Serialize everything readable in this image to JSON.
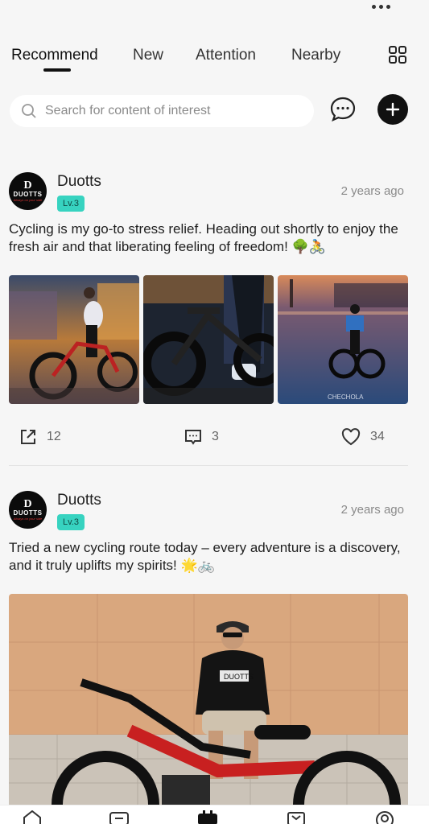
{
  "tabs": [
    {
      "label": "Recommend",
      "active": true
    },
    {
      "label": "New",
      "active": false
    },
    {
      "label": "Attention",
      "active": false
    },
    {
      "label": "Nearby",
      "active": false
    }
  ],
  "search": {
    "placeholder": "Search for content of interest"
  },
  "colors": {
    "accent": "#111111",
    "level_badge": "#37d3c0",
    "background": "#f6f6f6"
  },
  "icons": {
    "more": "more-horizontal-icon",
    "grid": "grid-icon",
    "search": "search-icon",
    "chat": "chat-bubble-icon",
    "add": "plus-icon",
    "share": "share-icon",
    "comment": "comment-icon",
    "like": "heart-icon"
  },
  "posts": [
    {
      "avatar_brand": "DUOTTS",
      "avatar_tagline": "Always on your side",
      "username": "Duotts",
      "level": "Lv.3",
      "time": "2 years ago",
      "text": "Cycling is my go-to stress relief. Heading out shortly to enjoy the fresh air and that liberating feeling of freedom! 🌳🚴",
      "shares": "12",
      "comments": "3",
      "likes": "34",
      "photo_watermark": "CHECHOLA"
    },
    {
      "avatar_brand": "DUOTTS",
      "avatar_tagline": "Always on your side",
      "username": "Duotts",
      "level": "Lv.3",
      "time": "2 years ago",
      "text": "Tried a new cycling route today – every adventure is a discovery, and it truly uplifts my spirits! 🌟🚲",
      "photo_shirt_text": "DUOTTS"
    }
  ],
  "bottom_nav": [
    "home-icon",
    "message-icon",
    "community-icon",
    "cart-icon",
    "profile-icon"
  ]
}
